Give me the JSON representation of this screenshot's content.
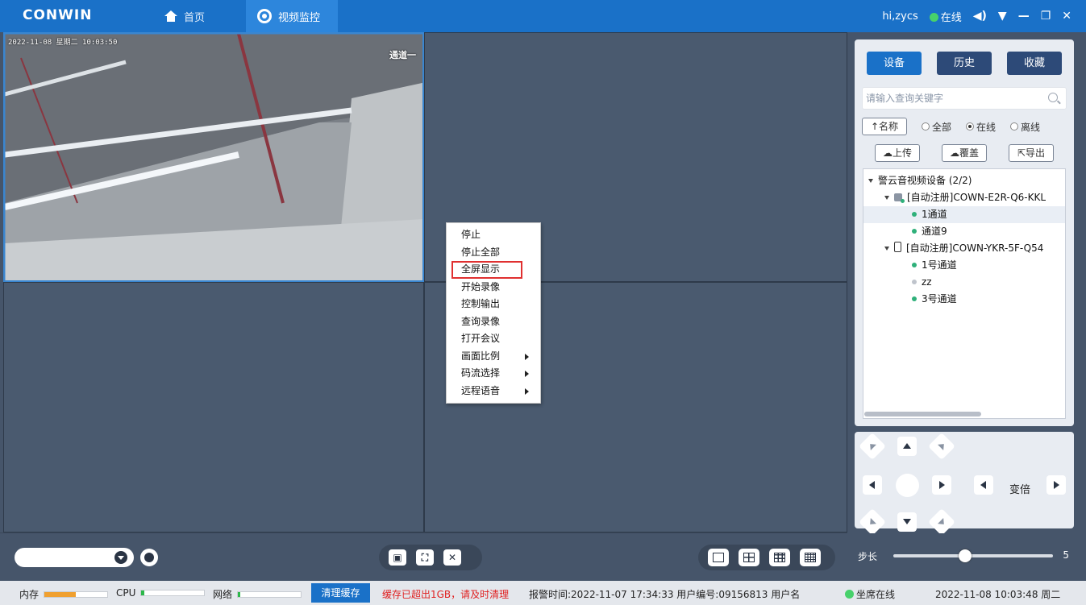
{
  "titlebar": {
    "logo": "CONWIN",
    "nav_home": "首页",
    "nav_video": "视频监控",
    "user": "hi,zycs",
    "status": "在线",
    "volume_icon": "speaker-icon",
    "dropdown_icon": "chevron-down-icon",
    "minimize_icon": "minimize-icon",
    "restore_icon": "restore-icon",
    "close_icon": "close-icon",
    "accent": "#1a71c8"
  },
  "video": {
    "feed_time": "2022-11-08 星期二 10:03:50",
    "feed_tag": "通道一"
  },
  "context_menu": {
    "items": [
      {
        "label": "停止",
        "submenu": false
      },
      {
        "label": "停止全部",
        "submenu": false
      },
      {
        "label": "全屏显示",
        "submenu": false,
        "highlighted": true
      },
      {
        "label": "开始录像",
        "submenu": false
      },
      {
        "label": "控制输出",
        "submenu": false
      },
      {
        "label": "查询录像",
        "submenu": false
      },
      {
        "label": "打开会议",
        "submenu": false
      },
      {
        "label": "画面比例",
        "submenu": true
      },
      {
        "label": "码流选择",
        "submenu": true
      },
      {
        "label": "远程语音",
        "submenu": true
      }
    ]
  },
  "panel": {
    "tabs": [
      "设备",
      "历史",
      "收藏"
    ],
    "search_placeholder": "请输入查询关键字",
    "sort_label": "↑名称",
    "filter": [
      "全部",
      "在线",
      "离线"
    ],
    "filter_selected": "在线",
    "actions": [
      "上传",
      "覆盖",
      "导出"
    ],
    "tree": {
      "root": "警云音视频设备 (2/2)",
      "devices": [
        {
          "name": "[自动注册]COWN-E2R-Q6-KKL",
          "channels": [
            {
              "name": "1通道",
              "online": true
            },
            {
              "name": "通道9",
              "online": true
            }
          ]
        },
        {
          "name": "[自动注册]COWN-YKR-5F-Q54",
          "channels": [
            {
              "name": "1号通道",
              "online": true
            },
            {
              "name": "zz",
              "online": false
            },
            {
              "name": "3号通道",
              "online": true
            }
          ]
        }
      ]
    }
  },
  "ptz": {
    "zoom_label": "变倍",
    "step_label": "步长",
    "step_value": "5",
    "step_fraction": 0.45
  },
  "status": {
    "mem_label": "内存",
    "cpu_label": "CPU",
    "net_label": "网络",
    "mem_fill": 0.5,
    "cpu_fill": 0.04,
    "net_fill": 0.04,
    "mem_color": "#f0a030",
    "cpu_color": "#2db84a",
    "net_color": "#2db84a",
    "clear_btn": "清理缓存",
    "warning": "缓存已超出1GB，请及时清理",
    "warning_color": "#e02020",
    "alarm": "报警时间:2022-11-07 17:34:33  用户编号:09156813  用户名",
    "seat": "坐席在线",
    "datetime": "2022-11-08 10:03:48 周二"
  }
}
